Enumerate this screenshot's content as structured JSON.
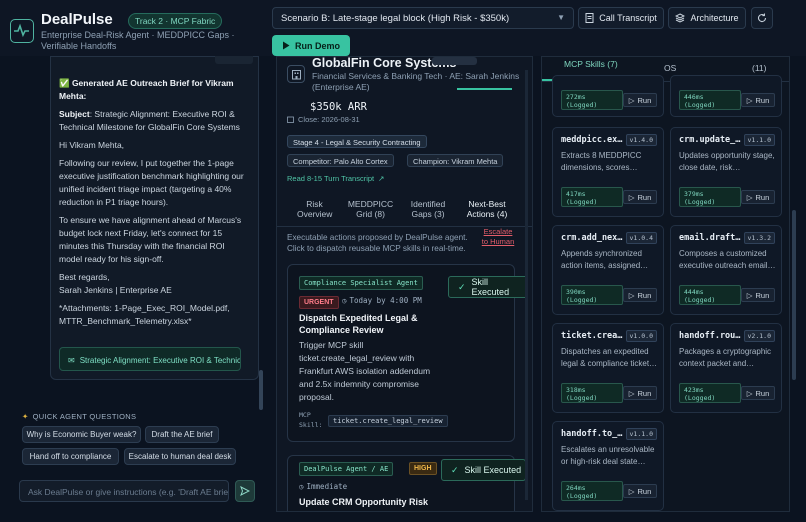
{
  "app": {
    "brand": "DealPulse",
    "track": "Track 2 · MCP Fabric",
    "subtitle": "Enterprise Deal-Risk Agent · MEDDPICC Gaps · Verifiable Handoffs"
  },
  "toolbar": {
    "scenario_value": "Scenario B: Late-stage legal block (High Risk - $350k)",
    "call_transcript_label": "Call Transcript",
    "architecture_label": "Architecture",
    "run_demo_label": "Run Demo"
  },
  "email": {
    "header": "✅ Generated AE Outreach Brief for Vikram Mehta:",
    "subject_label": "Subject",
    "subject_text": ": Strategic Alignment: Executive ROI & Technical Milestone for GlobalFin Core Systems",
    "greeting": "Hi Vikram Mehta,",
    "para1": "Following our review, I put together the 1-page executive justification benchmark highlighting our unified incident triage impact (targeting a 40% reduction in P1 triage hours).",
    "para2": "To ensure we have alignment ahead of Marcus's budget lock next Friday, let's connect for 15 minutes this Thursday with the financial ROI model ready for his sign-off.",
    "regards": "Best regards,",
    "signature": "Sarah Jenkins | Enterprise AE",
    "attachments": "*Attachments: 1-Page_Exec_ROI_Model.pdf, MTTR_Benchmark_Telemetry.xlsx*",
    "chip_label": "Strategic Alignment: Executive ROI & Technical Milestone"
  },
  "quick_questions": {
    "heading": "QUICK AGENT QUESTIONS",
    "items": [
      "Why is Economic Buyer weak?",
      "Draft the AE brief",
      "Hand off to compliance",
      "Escalate to human deal desk"
    ]
  },
  "chat": {
    "placeholder": "Ask DealPulse or give instructions (e.g. 'Draft AE brief')"
  },
  "account": {
    "name": "GlobalFin Core Systems",
    "sub": "Financial Services & Banking Tech · AE: Sarah Jenkins (Enterprise AE)",
    "arr": "$350k ARR",
    "close": "Close: 2026-08-31",
    "stage": "Stage 4 - Legal & Security Contracting",
    "competitor": "Competitor: Palo Alto Cortex",
    "champion": "Champion: Vikram Mehta",
    "transcript_link": "Read 8-15 Turn Transcript"
  },
  "tabs": [
    {
      "label": "Risk Overview"
    },
    {
      "label": "MEDDPICC Grid (8)"
    },
    {
      "label": "Identified Gaps (3)"
    },
    {
      "label": "Next-Best Actions (4)"
    }
  ],
  "actions": {
    "intro": "Executable actions proposed by DealPulse agent. Click to dispatch reusable MCP skills in real-time.",
    "escalate": "Escalate to Human",
    "items": [
      {
        "agent": "Compliance Specialist Agent",
        "priority": "URGENT",
        "due": "Today by 4:00 PM",
        "executed": "Skill Executed",
        "title": "Dispatch Expedited Legal & Compliance Review",
        "body": "Trigger MCP skill ticket.create_legal_review with Frankfurt AWS isolation addendum and 2.5x indemnity compromise proposal.",
        "skill_label": "MCP Skill:",
        "skill": "ticket.create_legal_review"
      },
      {
        "agent": "DealPulse Agent / AE",
        "priority": "HIGH",
        "due": "Immediate",
        "executed": "Skill Executed",
        "title": "Update CRM Opportunity Risk"
      }
    ]
  },
  "skills_panel": {
    "tabs": [
      "MCP Skills (7)",
      "OS",
      "(11)"
    ],
    "skills": [
      {
        "name": "",
        "version": "",
        "desc": "",
        "latency": "272ms (Logged)",
        "run": "Run"
      },
      {
        "name": "",
        "version": "",
        "desc": "",
        "latency": "446ms (Logged)",
        "run": "Run"
      },
      {
        "name": "meddpicc.ex…",
        "version": "v1.4.0",
        "desc": "Extracts 8 MEDDPICC dimensions, scores…",
        "latency": "417ms (Logged)",
        "run": "Run"
      },
      {
        "name": "crm.update_…",
        "version": "v1.1.0",
        "desc": "Updates opportunity stage, close date, risk…",
        "latency": "379ms (Logged)",
        "run": "Run"
      },
      {
        "name": "crm.add_nex…",
        "version": "v1.0.4",
        "desc": "Appends synchronized action items, assigned…",
        "latency": "390ms (Logged)",
        "run": "Run"
      },
      {
        "name": "email.draft…",
        "version": "v1.3.2",
        "desc": "Composes a customized executive outreach email…",
        "latency": "444ms (Logged)",
        "run": "Run"
      },
      {
        "name": "ticket.crea…",
        "version": "v1.0.0",
        "desc": "Dispatches an expedited legal & compliance ticket…",
        "latency": "318ms (Logged)",
        "run": "Run"
      },
      {
        "name": "handoff.rou…",
        "version": "v2.1.0",
        "desc": "Packages a cryptographic context packet and…",
        "latency": "423ms (Logged)",
        "run": "Run"
      },
      {
        "name": "handoff.to_…",
        "version": "v1.1.0",
        "desc": "Escalates an unresolvable or high-risk deal state…",
        "latency": "264ms (Logged)",
        "run": "Run"
      }
    ]
  }
}
